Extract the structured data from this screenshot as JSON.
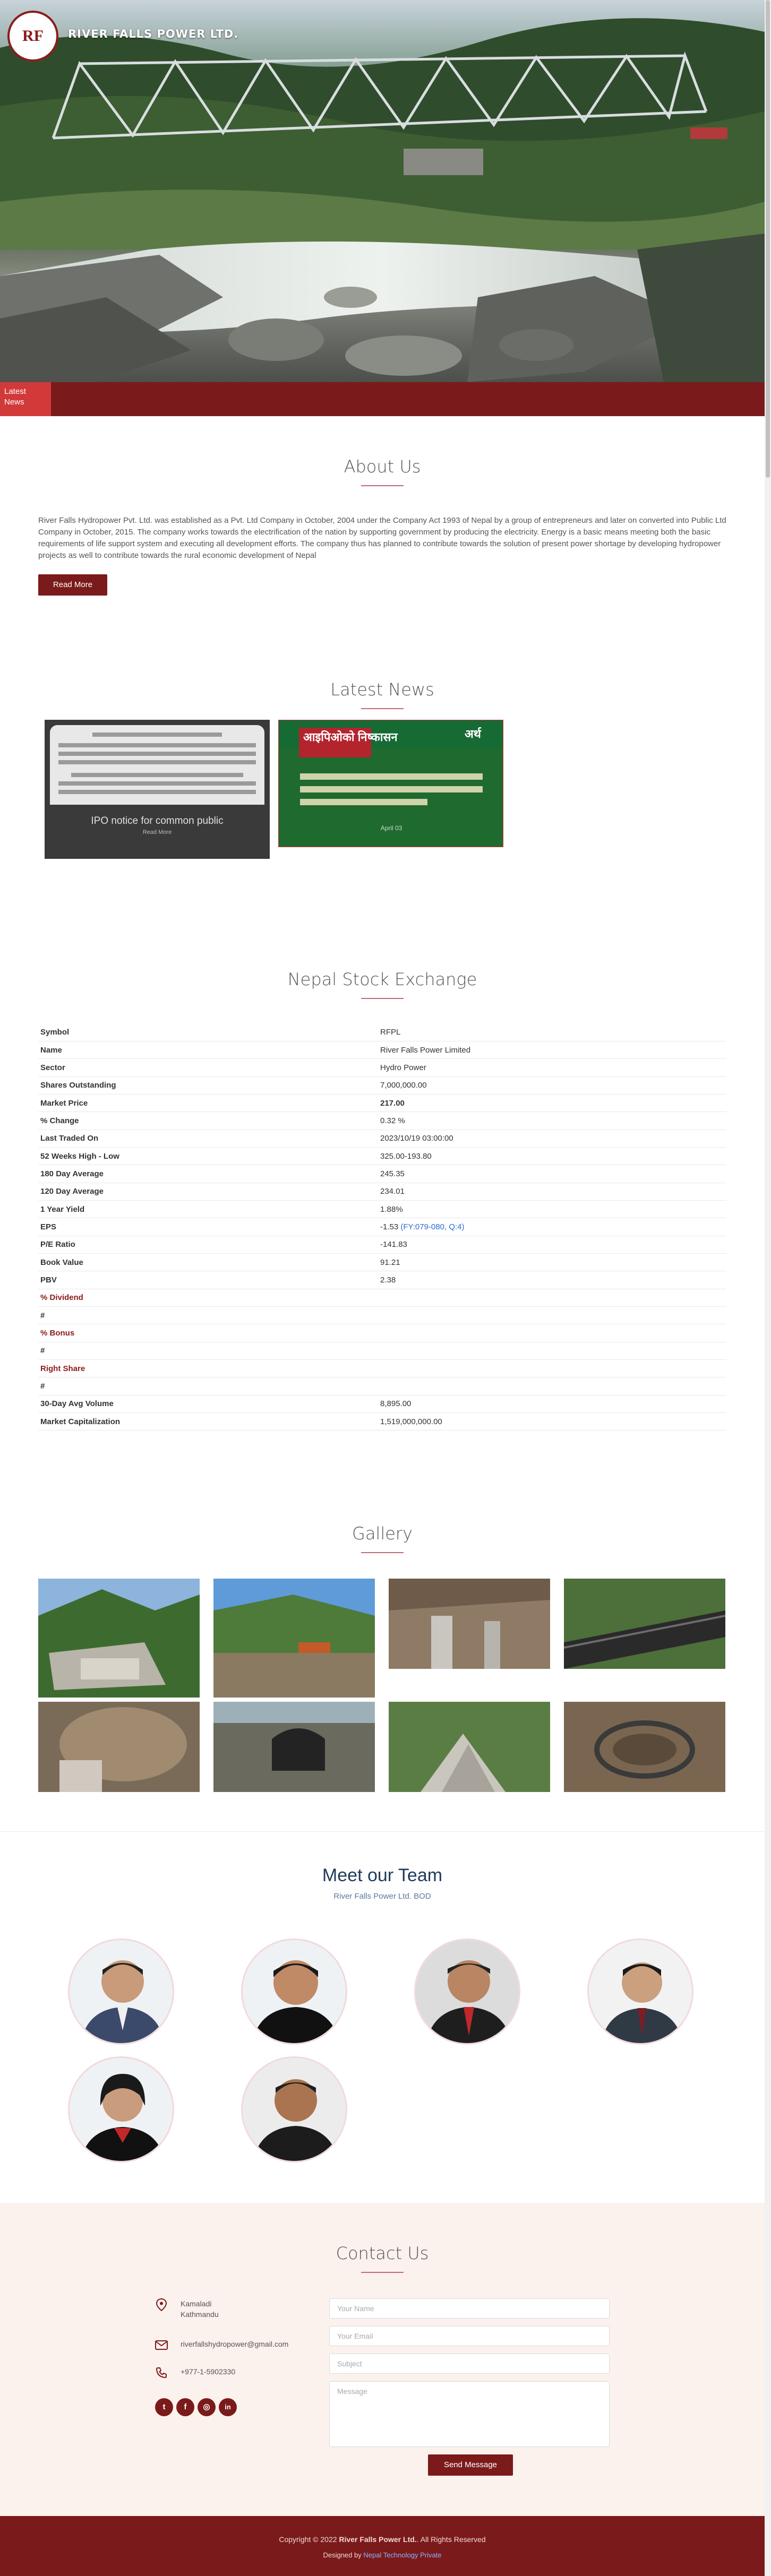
{
  "site": {
    "brand": "RIVER FALLS POWER LTD.",
    "logo_text": "RF",
    "news_label_1": "Latest",
    "news_label_2": "News"
  },
  "about": {
    "title": "About Us",
    "text": "River Falls Hydropower Pvt. Ltd. was established as a Pvt. Ltd Company in October, 2004 under the Company Act 1993 of Nepal by a group of entrepreneurs and later on converted into Public Ltd Company in October, 2015. The company works towards the electrification of the nation by supporting government by producing the electricity. Energy is a basic means meeting both the basic requirements of life support system and executing all development efforts. The company thus has planned to contribute towards the solution of present power shortage by developing hydropower projects as well to contribute towards the rural economic development of Nepal",
    "button": "Read More"
  },
  "news": {
    "title": "Latest News",
    "items": [
      {
        "caption": "IPO notice for common public",
        "read": "Read More"
      },
      {
        "head": "आइपिओको निष्कासन",
        "brand": "अर्थ",
        "date": "April 03"
      }
    ]
  },
  "nepse": {
    "title": "Nepal Stock Exchange",
    "rows": [
      {
        "k": "Symbol",
        "v": "RFPL"
      },
      {
        "k": "Name",
        "v": "River Falls Power Limited"
      },
      {
        "k": "Sector",
        "v": "Hydro Power"
      },
      {
        "k": "Shares Outstanding",
        "v": "7,000,000.00"
      },
      {
        "k": "Market Price",
        "v": "217.00"
      },
      {
        "k": "% Change",
        "v": "0.32 %"
      },
      {
        "k": "Last Traded On",
        "v": "2023/10/19 03:00:00"
      },
      {
        "k": "52 Weeks High - Low",
        "v": "325.00-193.80"
      },
      {
        "k": "180 Day Average",
        "v": "245.35"
      },
      {
        "k": "120 Day Average",
        "v": "234.01"
      },
      {
        "k": "1 Year Yield",
        "v": "1.88%"
      },
      {
        "k": "EPS",
        "v": "-1.53",
        "v2": "(FY:079-080, Q:4)"
      },
      {
        "k": "P/E Ratio",
        "v": "-141.83"
      },
      {
        "k": "Book Value",
        "v": "91.21"
      },
      {
        "k": "PBV",
        "v": "2.38"
      },
      {
        "k": "% Dividend",
        "v": ""
      },
      {
        "k": "#",
        "v": ""
      },
      {
        "k": "% Bonus",
        "v": ""
      },
      {
        "k": "#",
        "v": ""
      },
      {
        "k": "Right Share",
        "v": ""
      },
      {
        "k": "#",
        "v": ""
      },
      {
        "k": "30-Day Avg Volume",
        "v": "8,895.00"
      },
      {
        "k": "Market Capitalization",
        "v": "1,519,000,000.00"
      }
    ]
  },
  "gallery": {
    "title": "Gallery"
  },
  "team": {
    "title": "Meet our Team",
    "subtitle": "River Falls Power Ltd. BOD"
  },
  "contact": {
    "title": "Contact Us",
    "address_1": "Kamaladi",
    "address_2": "Kathmandu",
    "email": "riverfallshydropower@gmail.com",
    "phone": "+977-1-5902330",
    "social": [
      "t",
      "f",
      "◎",
      "in"
    ],
    "ph_name": "Your Name",
    "ph_email": "Your Email",
    "ph_subject": "Subject",
    "ph_message": "Message",
    "send": "Send Message"
  },
  "footer": {
    "copy_prefix": "Copyright © 2022",
    "copy_brand": "River Falls Power Ltd.",
    "copy_suffix": "All Rights Reserved",
    "designed_prefix": "Designed by",
    "designed_link": "Nepal Technology Private"
  },
  "colors": {
    "accent": "#7b1a1a",
    "accent_light": "#d23a3a",
    "link": "#2e6bd3",
    "title_line": "#c06a78"
  },
  "icons": [
    "map-pin-icon",
    "envelope-icon",
    "phone-icon",
    "twitter-icon",
    "facebook-icon",
    "instagram-icon",
    "linkedin-icon"
  ]
}
